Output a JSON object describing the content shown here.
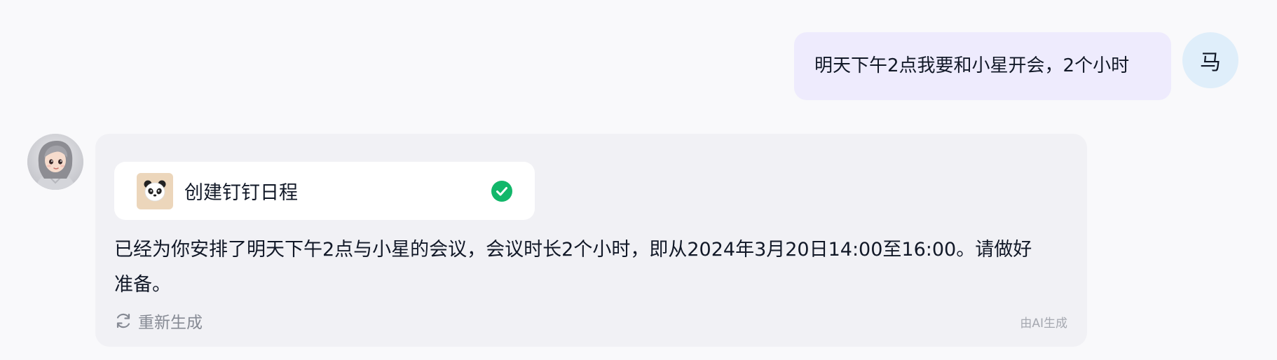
{
  "user_message": {
    "text": "明天下午2点我要和小星开会，2个小时",
    "avatar_initial": "马",
    "bubble_color": "#eeebfd",
    "avatar_color": "#dfeefa"
  },
  "ai_message": {
    "avatar_icon": "girl-avatar-illustration",
    "tool_card": {
      "icon": "panda-icon",
      "title": "创建钉钉日程",
      "status_icon": "check-circle-icon",
      "status_color": "#12b76a"
    },
    "reply_lines": [
      "已经为你安排了明天下午2点与小星的会议，会议时长2个小时，即从2024年3月20日14:00至16:00。请做好",
      "准备。"
    ],
    "regenerate_label": "重新生成",
    "regenerate_icon": "refresh-icon",
    "ai_note": "由AI生成",
    "bubble_color": "#f1f1f5"
  }
}
